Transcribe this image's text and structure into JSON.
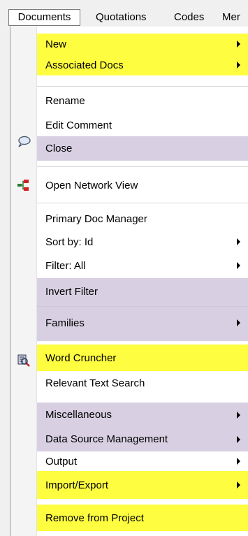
{
  "colors": {
    "highlight_yellow": "#fffd40",
    "highlight_purple": "#d8d0e2"
  },
  "menubar": {
    "documents": "Documents",
    "quotations": "Quotations",
    "codes": "Codes",
    "memos": "Mer"
  },
  "menu": {
    "new": "New",
    "associated_docs": "Associated Docs",
    "rename": "Rename",
    "edit_comment": "Edit Comment",
    "close": "Close",
    "open_network_view": "Open Network View",
    "primary_doc_manager": "Primary Doc Manager",
    "sort_by": "Sort by: Id",
    "filter": "Filter: All",
    "invert_filter": "Invert Filter",
    "families": "Families",
    "word_cruncher": "Word Cruncher",
    "relevant_text_search": "Relevant Text Search",
    "miscellaneous": "Miscellaneous",
    "data_source_management": "Data Source Management",
    "output": "Output",
    "import_export": "Import/Export",
    "remove_from_project": "Remove from Project"
  },
  "icons": {
    "edit_comment": "speech-bubble-icon",
    "open_network_view": "network-icon",
    "word_cruncher": "word-cruncher-icon"
  }
}
